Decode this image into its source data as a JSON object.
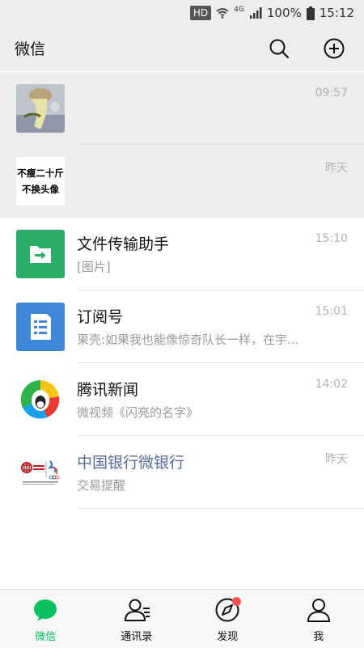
{
  "status_bar": {
    "hd": "HD",
    "network": "4G",
    "battery": "100%",
    "time": "15:12"
  },
  "header": {
    "title": "微信",
    "search_icon": "search-icon",
    "add_icon": "plus-circle-icon"
  },
  "chats": [
    {
      "name": "",
      "preview": "",
      "time": "09:57",
      "pinned": true,
      "avatar": "photo-avatar"
    },
    {
      "name": "",
      "preview": "",
      "time": "昨天",
      "pinned": true,
      "avatar": "text-poster-avatar",
      "avatar_text": [
        "不瘦二十斤",
        "不换头像"
      ]
    },
    {
      "name": "文件传输助手",
      "preview": "[图片]",
      "time": "15:10",
      "avatar": "file-transfer-icon",
      "avatar_color": "#2aae67"
    },
    {
      "name": "订阅号",
      "preview": "果壳:如果我也能像惊奇队长一样，在宇...",
      "time": "15:01",
      "avatar": "subscription-icon",
      "avatar_color": "#3e86d7"
    },
    {
      "name": "腾讯新闻",
      "preview": "微视频《闪亮的名字》",
      "time": "14:02",
      "avatar": "tencent-news-logo"
    },
    {
      "name": "中国银行微银行",
      "preview": "交易提醒",
      "time": "昨天",
      "avatar": "bank-of-china-logo"
    }
  ],
  "tabbar": {
    "tabs": [
      {
        "label": "微信",
        "icon": "chat-bubble-icon",
        "active": true
      },
      {
        "label": "通讯录",
        "icon": "contacts-icon",
        "active": false
      },
      {
        "label": "发现",
        "icon": "compass-icon",
        "active": false,
        "badge": "red-dot"
      },
      {
        "label": "我",
        "icon": "person-icon",
        "active": false
      }
    ]
  },
  "colors": {
    "accent": "#07c160",
    "header_bg": "#ededed",
    "official_name": "#576b95",
    "badge": "#fa5151"
  }
}
